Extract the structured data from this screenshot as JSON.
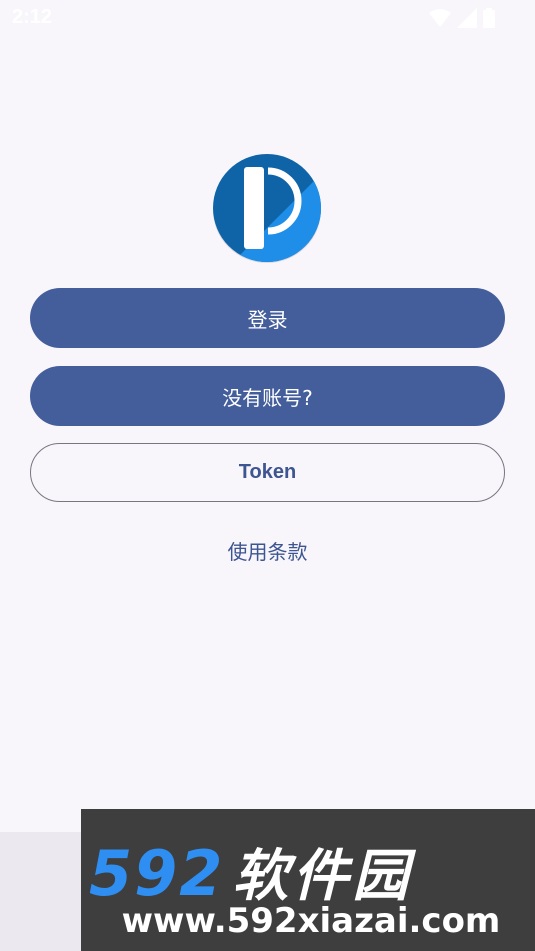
{
  "status_bar": {
    "time": "2:12",
    "icons": [
      "wifi-icon",
      "cellular-signal-icon",
      "battery-icon"
    ]
  },
  "logo": {
    "name": "app-logo",
    "colors": {
      "ring": "#0f5fa3",
      "ring_light": "#2a9af0",
      "bar": "#ffffff"
    }
  },
  "buttons": {
    "login": "登录",
    "no_account": "没有账号?",
    "token": "Token"
  },
  "terms_link": "使用条款",
  "watermark": {
    "number": "592",
    "brand_cn": "软件园",
    "url": "www.592xiazai.com"
  },
  "colors": {
    "background": "#f8f6fb",
    "primary": "#445e9c",
    "accent_text": "#3d5590"
  }
}
